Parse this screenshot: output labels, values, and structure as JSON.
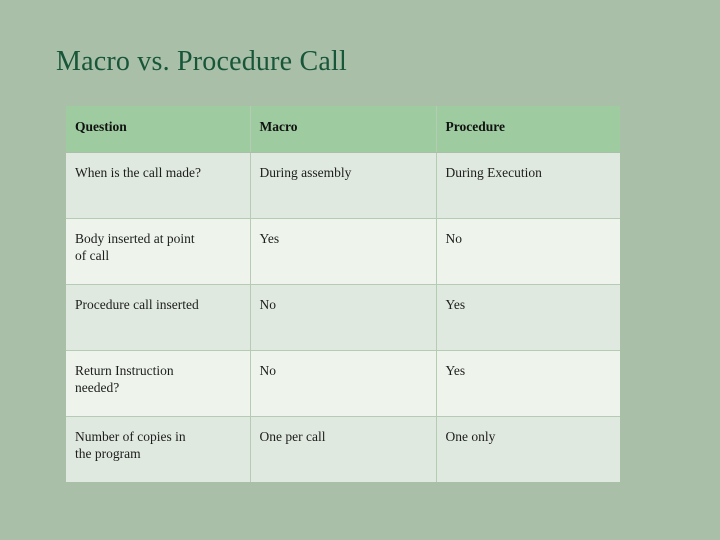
{
  "slide": {
    "title": "Macro vs. Procedure Call",
    "background_color": "#aabfa8",
    "title_color": "#18563a"
  },
  "table": {
    "header_background": "#9ecca0",
    "row_background_a": "#e0e9df",
    "row_background_b": "#eef4ec",
    "border_color": "#b6cbb4",
    "columns": [
      {
        "key": "question",
        "label": "Question"
      },
      {
        "key": "macro",
        "label": "Macro"
      },
      {
        "key": "procedure",
        "label": "Procedure"
      }
    ],
    "rows": [
      {
        "question": "When is the call made?",
        "macro": "During assembly",
        "procedure": "During Execution"
      },
      {
        "question": "Body inserted at point\nof call",
        "macro": "Yes",
        "procedure": "No"
      },
      {
        "question": "Procedure call inserted",
        "macro": "No",
        "procedure": "Yes"
      },
      {
        "question": "Return Instruction\nneeded?",
        "macro": "No",
        "procedure": "Yes"
      },
      {
        "question": "Number of copies in\nthe program",
        "macro": "One per call",
        "procedure": "One only"
      }
    ]
  }
}
